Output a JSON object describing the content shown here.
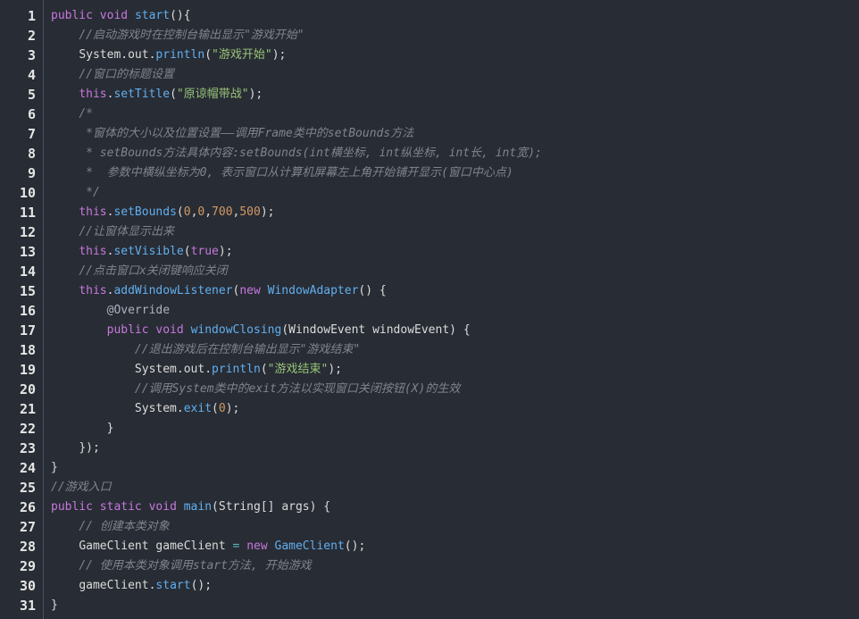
{
  "editor": {
    "line_numbers": [
      "1",
      "2",
      "3",
      "4",
      "5",
      "6",
      "7",
      "8",
      "9",
      "10",
      "11",
      "12",
      "13",
      "14",
      "15",
      "16",
      "17",
      "18",
      "19",
      "20",
      "21",
      "22",
      "23",
      "24",
      "25",
      "26",
      "27",
      "28",
      "29",
      "30",
      "31"
    ],
    "lines": [
      "public void start(){",
      "    //启动游戏时在控制台输出显示\"游戏开始\"",
      "    System.out.println(\"游戏开始\");",
      "    //窗口的标题设置",
      "    this.setTitle(\"原谅帽带战\");",
      "    /*",
      "     *窗体的大小以及位置设置——调用Frame类中的setBounds方法",
      "     * setBounds方法具体内容:setBounds(int横坐标, int纵坐标, int长, int宽);",
      "     *  参数中横纵坐标为0, 表示窗口从计算机屏幕左上角开始铺开显示(窗口中心点)",
      "     */",
      "    this.setBounds(0,0,700,500);",
      "    //让窗体显示出来",
      "    this.setVisible(true);",
      "    //点击窗口x关闭键响应关闭",
      "    this.addWindowListener(new WindowAdapter() {",
      "        @Override",
      "        public void windowClosing(WindowEvent windowEvent) {",
      "            //退出游戏后在控制台输出显示\"游戏结束\"",
      "            System.out.println(\"游戏结束\");",
      "            //调用System类中的exit方法以实现窗口关闭按钮(X)的生效",
      "            System.exit(0);",
      "        }",
      "    });",
      "}",
      "//游戏入口",
      "public static void main(String[] args) {",
      "    // 创建本类对象",
      "    GameClient gameClient = new GameClient();",
      "    // 使用本类对象调用start方法, 开始游戏",
      "    gameClient.start();",
      "}"
    ]
  }
}
